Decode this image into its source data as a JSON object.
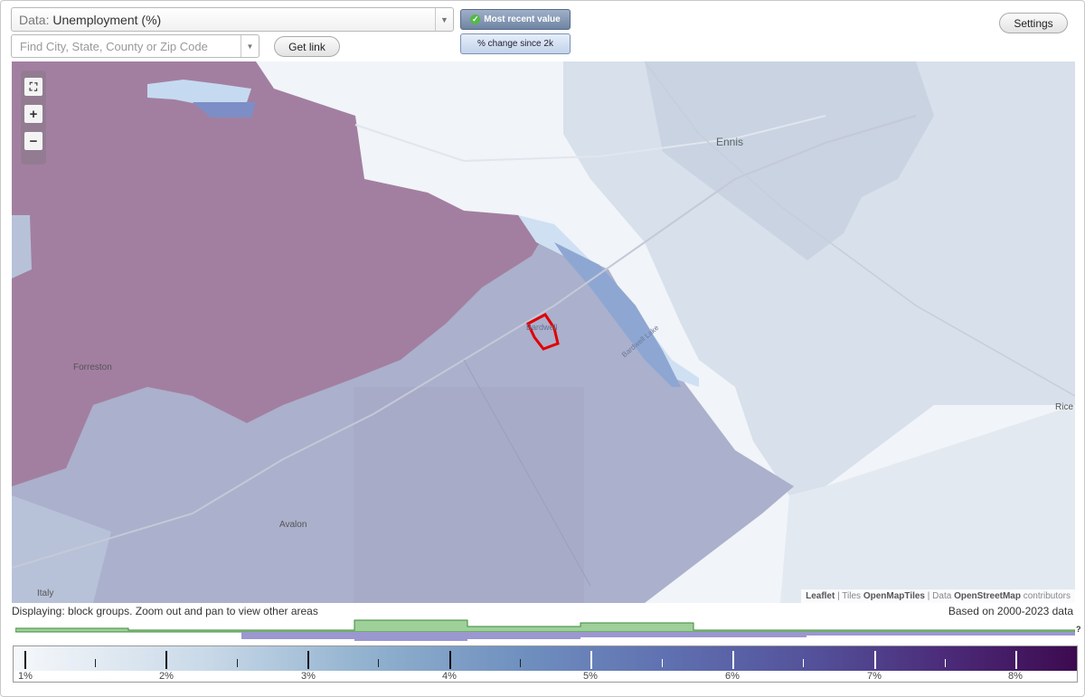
{
  "controls": {
    "data_prefix": "Data:",
    "data_value": "Unemployment (%)",
    "search_placeholder": "Find City, State, County or Zip Code",
    "get_link": "Get link",
    "most_recent": "Most recent value",
    "pct_change": "% change since 2k",
    "settings": "Settings"
  },
  "map": {
    "places": {
      "ennis": "Ennis",
      "forreston": "Forreston",
      "avalon": "Avalon",
      "italy": "Italy",
      "rice": "Rice",
      "bardwell": "Bardwell",
      "lake": "Bardwell Lake"
    },
    "attribution": {
      "leaflet": "Leaflet",
      "tiles_prefix": " | Tiles ",
      "tiles": "OpenMapTiles",
      "data_prefix": " | Data ",
      "data": "OpenStreetMap",
      "suffix": " contributors"
    }
  },
  "status": {
    "displaying": "Displaying: block groups. Zoom out and pan to view other areas",
    "based_on": "Based on 2000-2023 data",
    "unknown": "?"
  },
  "legend": {
    "labels": [
      "1%",
      "2%",
      "3%",
      "4%",
      "5%",
      "6%",
      "7%",
      "8%"
    ],
    "colors": {
      "low": "#f6f8fb",
      "high": "#3d0a4f"
    }
  },
  "colors": {
    "selected_outline": "#e00000",
    "high_region": "#a47fa0",
    "mid_region": "#a9aecb",
    "low_region": "#c5d2e1",
    "water": "#cfe0f3"
  }
}
